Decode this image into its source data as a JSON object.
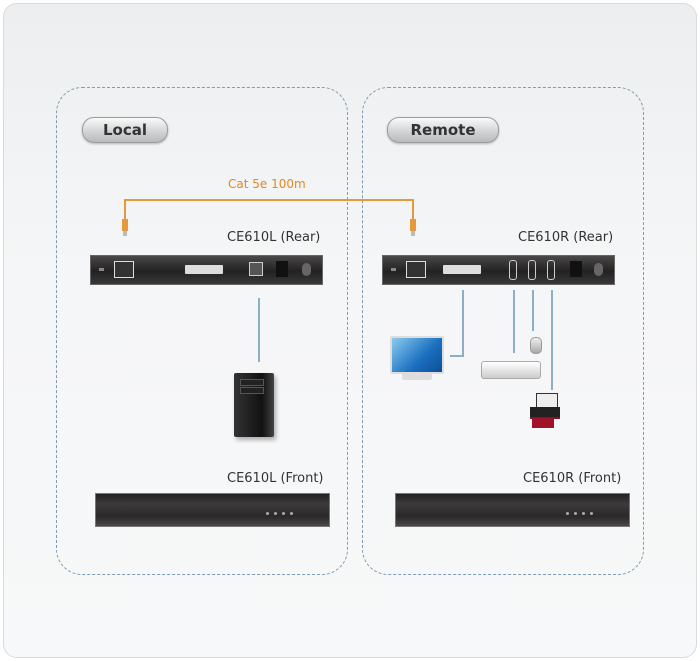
{
  "zones": {
    "local": {
      "label": "Local"
    },
    "remote": {
      "label": "Remote"
    }
  },
  "cable": {
    "label": "Cat 5e 100m",
    "color": "#e08a20"
  },
  "devices": {
    "local_rear": {
      "label": "CE610L (Rear)"
    },
    "remote_rear": {
      "label": "CE610R (Rear)"
    },
    "local_front": {
      "label": "CE610L (Front)"
    },
    "remote_front": {
      "label": "CE610R (Front)"
    }
  },
  "peripherals": {
    "local": [
      "computer"
    ],
    "remote": [
      "monitor",
      "keyboard",
      "mouse",
      "printer"
    ]
  }
}
